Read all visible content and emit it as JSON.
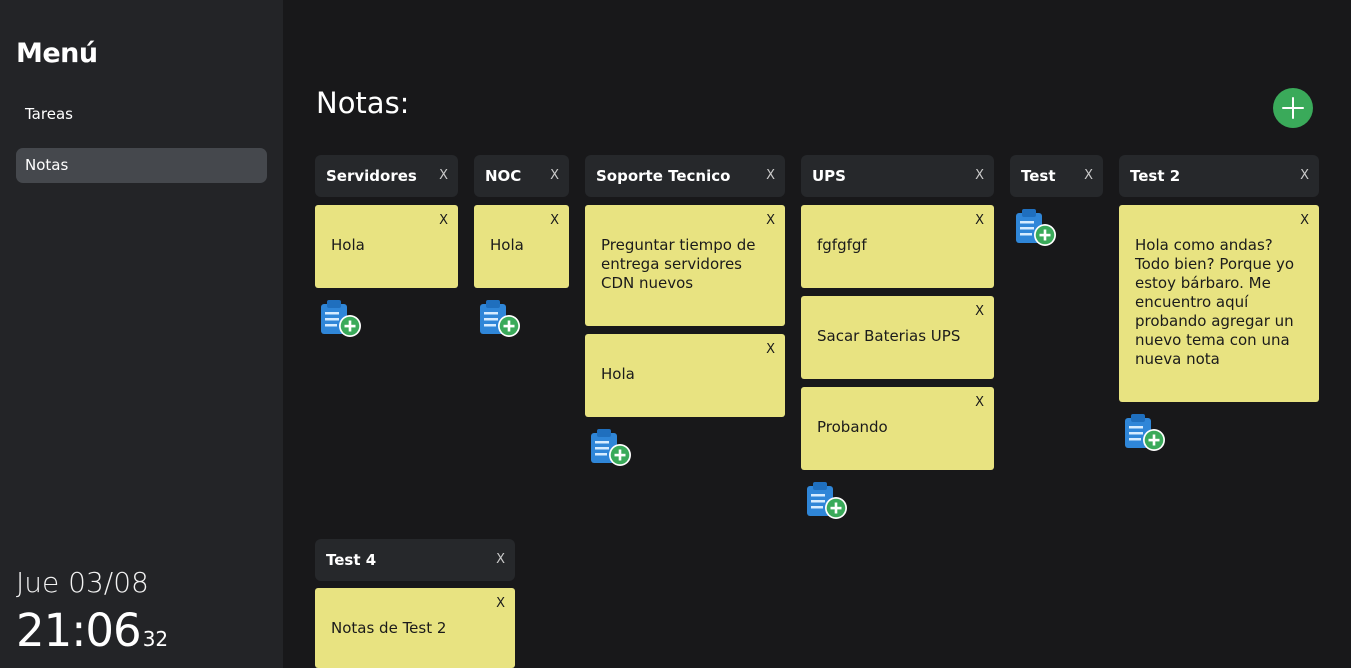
{
  "sidebar": {
    "title": "Menú",
    "items": [
      {
        "label": "Tareas",
        "active": false
      },
      {
        "label": "Notas",
        "active": true
      }
    ]
  },
  "clock": {
    "date": "Jue 03/08",
    "time": "21:06",
    "seconds": "32"
  },
  "main": {
    "title": "Notas:",
    "add_topic_icon": "plus-circle-icon",
    "close_label": "X",
    "add_note_icon": "clipboard-add-icon"
  },
  "columns": [
    {
      "title": "Servidores",
      "notes": [
        "Hola"
      ]
    },
    {
      "title": "NOC",
      "notes": [
        "Hola"
      ]
    },
    {
      "title": "Soporte Tecnico",
      "notes": [
        "Preguntar tiempo de entrega servidores CDN nuevos",
        "Hola"
      ]
    },
    {
      "title": "UPS",
      "notes": [
        "fgfgfgf",
        "Sacar Baterias UPS",
        "Probando"
      ]
    },
    {
      "title": "Test",
      "notes": []
    },
    {
      "title": "Test 2",
      "notes": [
        "Hola como andas? Todo bien? Porque yo estoy bárbaro. Me encuentro aquí probando agregar un nuevo tema con una nueva nota"
      ]
    },
    {
      "title": "Test 4",
      "notes": [
        "Notas de Test 2"
      ]
    }
  ],
  "colors": {
    "background": "#18181a",
    "sidebar": "#232427",
    "note": "#e8e381",
    "header": "#26282b",
    "accent_green": "#3aaa5a",
    "icon_blue": "#2f86d8"
  }
}
